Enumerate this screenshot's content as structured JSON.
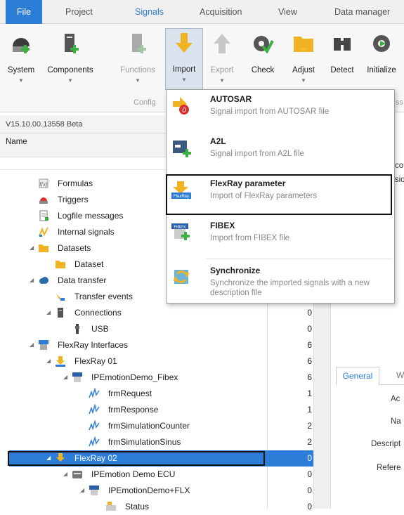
{
  "tabs": [
    "File",
    "Project",
    "Signals",
    "Acquisition",
    "View",
    "Data manager"
  ],
  "ribbon": {
    "buttons": {
      "system": "System",
      "components": "Components",
      "functions": "Functions",
      "import": "Import",
      "export": "Export",
      "check": "Check",
      "adjust": "Adjust",
      "detect": "Detect",
      "initialize": "Initialize"
    },
    "group_config": "Config",
    "group_ss": "ss"
  },
  "version": "V15.10.00.13558 Beta",
  "columns": {
    "name": "Name"
  },
  "tree": [
    {
      "label": "Formulas",
      "count": "",
      "icon": "formula-icon",
      "indent": 80,
      "tri": ""
    },
    {
      "label": "Triggers",
      "count": "",
      "icon": "trigger-icon",
      "indent": 80,
      "tri": ""
    },
    {
      "label": "Logfile messages",
      "count": "",
      "icon": "logfile-icon",
      "indent": 80,
      "tri": ""
    },
    {
      "label": "Internal signals",
      "count": "",
      "icon": "internal-signal-icon",
      "indent": 80,
      "tri": ""
    },
    {
      "label": "Datasets",
      "count": "",
      "icon": "folder-icon",
      "indent": 80,
      "tri": "◢"
    },
    {
      "label": "Dataset",
      "count": "",
      "icon": "folder-icon",
      "indent": 104,
      "tri": ""
    },
    {
      "label": "Data transfer",
      "count": "",
      "icon": "cloud-icon",
      "indent": 80,
      "tri": "◢"
    },
    {
      "label": "Transfer events",
      "count": "",
      "icon": "transfer-event-icon",
      "indent": 104,
      "tri": ""
    },
    {
      "label": "Connections",
      "count": "0",
      "icon": "connection-icon",
      "indent": 104,
      "tri": "◢"
    },
    {
      "label": "USB",
      "count": "0",
      "icon": "usb-icon",
      "indent": 128,
      "tri": ""
    },
    {
      "label": "FlexRay Interfaces",
      "count": "6",
      "icon": "flexray-interface-icon",
      "indent": 80,
      "tri": "◢"
    },
    {
      "label": "FlexRay 01",
      "count": "6",
      "icon": "flexray-channel-icon",
      "indent": 104,
      "tri": "◢"
    },
    {
      "label": "IPEmotionDemo_Fibex",
      "count": "6",
      "icon": "fibex-db-icon",
      "indent": 128,
      "tri": "◢"
    },
    {
      "label": "frmRequest",
      "count": "1",
      "icon": "signal-wave-icon",
      "indent": 152,
      "tri": ""
    },
    {
      "label": "frmResponse",
      "count": "1",
      "icon": "signal-wave-icon",
      "indent": 152,
      "tri": ""
    },
    {
      "label": "frmSimulationCounter",
      "count": "2",
      "icon": "signal-wave-icon",
      "indent": 152,
      "tri": ""
    },
    {
      "label": "frmSimulationSinus",
      "count": "2",
      "icon": "signal-wave-icon",
      "indent": 152,
      "tri": ""
    },
    {
      "label": "FlexRay 02",
      "count": "0",
      "icon": "flexray-channel-icon",
      "indent": 104,
      "tri": "◢",
      "selected": true
    },
    {
      "label": "IPEmotion Demo ECU",
      "count": "0",
      "icon": "ecu-icon",
      "indent": 128,
      "tri": "◢"
    },
    {
      "label": "IPEmotionDemo+FLX",
      "count": "0",
      "icon": "fibex-db-icon",
      "indent": 152,
      "tri": "◢"
    },
    {
      "label": "Status",
      "count": "0",
      "icon": "status-icon",
      "indent": 176,
      "tri": ""
    }
  ],
  "menu": [
    {
      "title": "AUTOSAR",
      "desc": "Signal import from AUTOSAR file",
      "icon": "autosar-icon"
    },
    {
      "title": "A2L",
      "desc": "Signal import from A2L file",
      "icon": "a2l-icon"
    },
    {
      "title": "FlexRay parameter",
      "desc": "Import of FlexRay parameters",
      "icon": "flexray-import-icon"
    },
    {
      "title": "FIBEX",
      "desc": "Import from FIBEX file",
      "icon": "fibex-icon"
    },
    {
      "title": "Synchronize",
      "desc": "Synchronize the imported signals with a new description file",
      "icon": "synchronize-icon"
    }
  ],
  "right": {
    "tab_general": "General",
    "tab_w": "W",
    "labels": [
      "Ac",
      "Na",
      "Descript",
      "Refere"
    ],
    "top1": "co",
    "top2": "rsio"
  }
}
